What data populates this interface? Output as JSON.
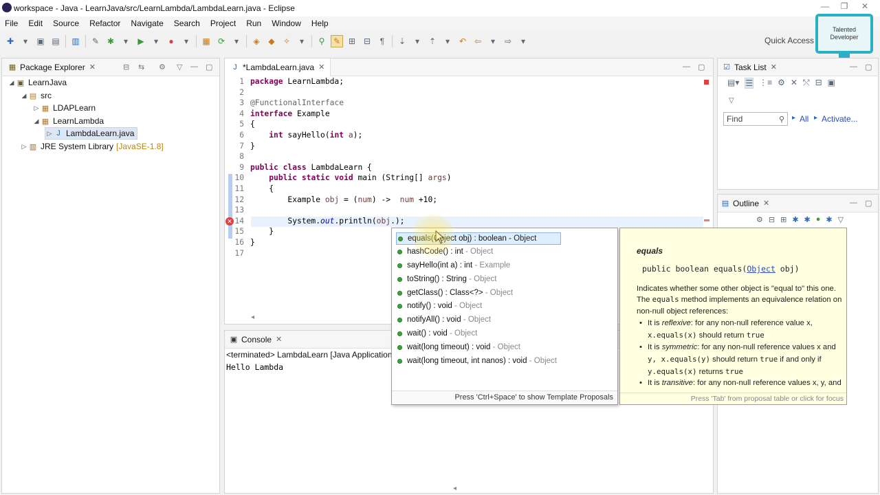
{
  "window": {
    "title": "workspace - Java - LearnJava/src/LearnLambda/LambdaLearn.java - Eclipse"
  },
  "menu": [
    "File",
    "Edit",
    "Source",
    "Refactor",
    "Navigate",
    "Search",
    "Project",
    "Run",
    "Window",
    "Help"
  ],
  "quick_access": "Quick Access",
  "watermark": {
    "line1": "Talented",
    "line2": "Developer"
  },
  "package_explorer": {
    "tab": "Package Explorer",
    "tree": [
      {
        "label": "LearnJava",
        "decoration": ""
      },
      {
        "label": "src",
        "decoration": ""
      },
      {
        "label": "LDAPLearn",
        "decoration": ""
      },
      {
        "label": "LearnLambda",
        "decoration": ""
      },
      {
        "label": "LambdaLearn.java",
        "decoration": ""
      },
      {
        "label": "JRE System Library",
        "decoration": "[JavaSE-1.8]"
      }
    ]
  },
  "editor": {
    "tab": "*LambdaLearn.java",
    "line_numbers": [
      "1",
      "2",
      "3",
      "4",
      "5",
      "6",
      "7",
      "8",
      "9",
      "10",
      "11",
      "12",
      "13",
      "14",
      "15",
      "16",
      "17"
    ]
  },
  "task_list": {
    "tab": "Task List",
    "find_placeholder": "Find",
    "all": "All",
    "activate": "Activate..."
  },
  "outline": {
    "tab": "Outline"
  },
  "console": {
    "tab": "Console",
    "status": "<terminated> LambdaLearn [Java Application] C",
    "output": "Hello Lambda"
  },
  "proposals": {
    "items": [
      {
        "sig": "equals(Object obj) : boolean",
        "owner": "- Object"
      },
      {
        "sig": "hashCode() : int",
        "owner": "- Object"
      },
      {
        "sig": "sayHello(int a) : int",
        "owner": "- Example"
      },
      {
        "sig": "toString() : String",
        "owner": "- Object"
      },
      {
        "sig": "getClass() : Class<?>",
        "owner": "- Object"
      },
      {
        "sig": "notify() : void",
        "owner": "- Object"
      },
      {
        "sig": "notifyAll() : void",
        "owner": "- Object"
      },
      {
        "sig": "wait() : void",
        "owner": "- Object"
      },
      {
        "sig": "wait(long timeout) : void",
        "owner": "- Object"
      },
      {
        "sig": "wait(long timeout, int nanos) : void",
        "owner": "- Object"
      }
    ],
    "footer": "Press 'Ctrl+Space' to show Template Proposals"
  },
  "doc": {
    "title": "equals",
    "sig_pre": "public boolean equals(",
    "sig_link": "Object",
    "sig_post": " obj)",
    "para1": "Indicates whether some other object is \"equal to\" this one.",
    "para2_pre": "The ",
    "para2_code": "equals",
    "para2_post": " method implements an equivalence relation on non-null object references:",
    "b1_pre": "It is ",
    "b1_em": "reflexive",
    "b1_post": ": for any non-null reference value x,",
    "b1_code": "x.equals(x)",
    "b1_tail": " should return ",
    "b1_true": "true",
    "b2_pre": "It is ",
    "b2_em": "symmetric",
    "b2_post": ": for any non-null reference values x and",
    "b2_code1": "y, x.equals(y)",
    "b2_mid": " should return ",
    "b2_true": "true",
    "b2_mid2": " if and only if",
    "b2_code2": "y.equals(x)",
    "b2_tail": " returns ",
    "b2_true2": "true",
    "b3_pre": "It is ",
    "b3_em": "transitive",
    "b3_post": ": for any non-null reference values x, y, and",
    "footer": "Press 'Tab' from proposal table or click for focus"
  },
  "colors": {
    "selection": "#ddeeff",
    "doc_bg": "#ffffe1",
    "keyword": "#7f0055",
    "field": "#0000c0"
  }
}
